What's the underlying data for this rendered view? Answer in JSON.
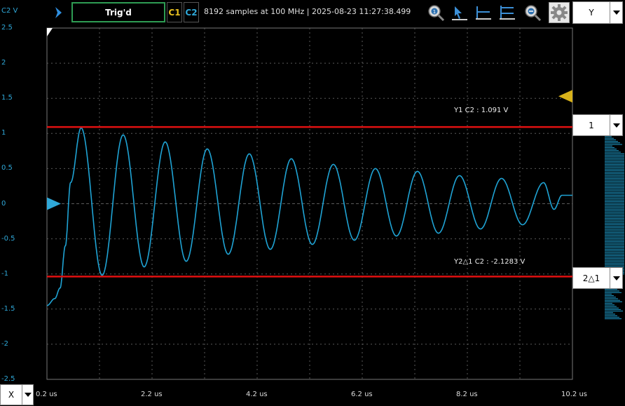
{
  "toolbar": {
    "trigger_status": "Trig'd",
    "c1_label": "C1",
    "c2_label": "C2",
    "acq_info": "8192 samples at 100 MHz | 2025-08-23 11:27:38.499",
    "run_icon": "chevron-right-icon",
    "tools": [
      "zoom-in-icon",
      "cursor-arrow-icon",
      "baseline-cursor-icon",
      "multi-cursor-icon",
      "zoom-out-icon",
      "gear-icon"
    ]
  },
  "axis_selectors": {
    "y_axis": "Y",
    "x_axis": "X",
    "cursor1": "1",
    "cursor2": "2△1"
  },
  "cursors": {
    "y1_readout": "Y1 C2 : 1.091 V",
    "y2_readout": "Y2△1 C2 : -2.1283 V",
    "y1_value": 1.091,
    "y2_value": -1.0373
  },
  "colors": {
    "trace": "#1fa3d4",
    "cursor_line": "#e01010",
    "grid": "#5a5a5a",
    "trigger_marker": "#d8b21a",
    "c1": "#e8c020",
    "c2": "#2fa8d8"
  },
  "chart_data": {
    "type": "line",
    "title": "",
    "ylabel": "C2 V",
    "xlabel": "",
    "x_unit": "us",
    "xlim": [
      0.2,
      10.2
    ],
    "ylim": [
      -2.5,
      2.5
    ],
    "x_ticks": [
      "0.2 us",
      "2.2 us",
      "4.2 us",
      "6.2 us",
      "8.2 us",
      "10.2 us"
    ],
    "y_ticks": [
      "2.5",
      "2",
      "1.5",
      "1",
      "0.5",
      "0",
      "-0.5",
      "-1",
      "-1.5",
      "-2",
      "-2.5"
    ],
    "grid": true,
    "series": [
      {
        "x": [
          0.2,
          0.35,
          0.45,
          0.55,
          0.65,
          0.85,
          1.25,
          1.65,
          2.05,
          2.45,
          2.85,
          3.25,
          3.65,
          4.05,
          4.45,
          4.85,
          5.25,
          5.65,
          6.05,
          6.45,
          6.85,
          7.25,
          7.65,
          8.05,
          8.45,
          8.85,
          9.25,
          9.65,
          9.85,
          10.0,
          10.2
        ],
        "y": [
          -1.45,
          -1.35,
          -1.2,
          -0.6,
          0.3,
          1.08,
          -1.02,
          0.98,
          -0.9,
          0.88,
          -0.82,
          0.78,
          -0.72,
          0.71,
          -0.65,
          0.64,
          -0.58,
          0.56,
          -0.52,
          0.5,
          -0.46,
          0.46,
          -0.42,
          0.4,
          -0.36,
          0.36,
          -0.3,
          0.3,
          -0.08,
          0.12,
          0.12
        ]
      }
    ]
  }
}
